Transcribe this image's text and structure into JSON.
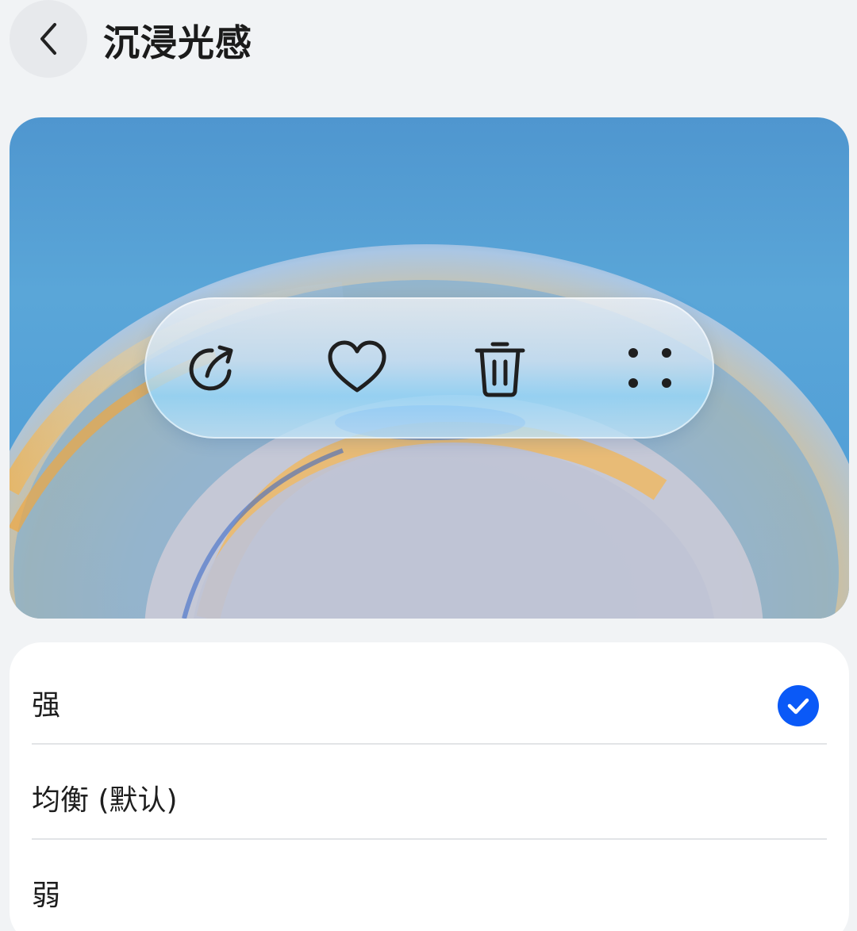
{
  "header": {
    "title": "沉浸光感"
  },
  "preview": {
    "toolbar_icons": [
      "share-icon",
      "heart-icon",
      "trash-icon",
      "more-dots-icon"
    ]
  },
  "options": [
    {
      "label": "强",
      "selected": true
    },
    {
      "label": "均衡 (默认)",
      "selected": false
    },
    {
      "label": "弱",
      "selected": false
    }
  ],
  "colors": {
    "accent": "#0a59f7",
    "background": "#f1f3f5",
    "card": "#ffffff"
  }
}
